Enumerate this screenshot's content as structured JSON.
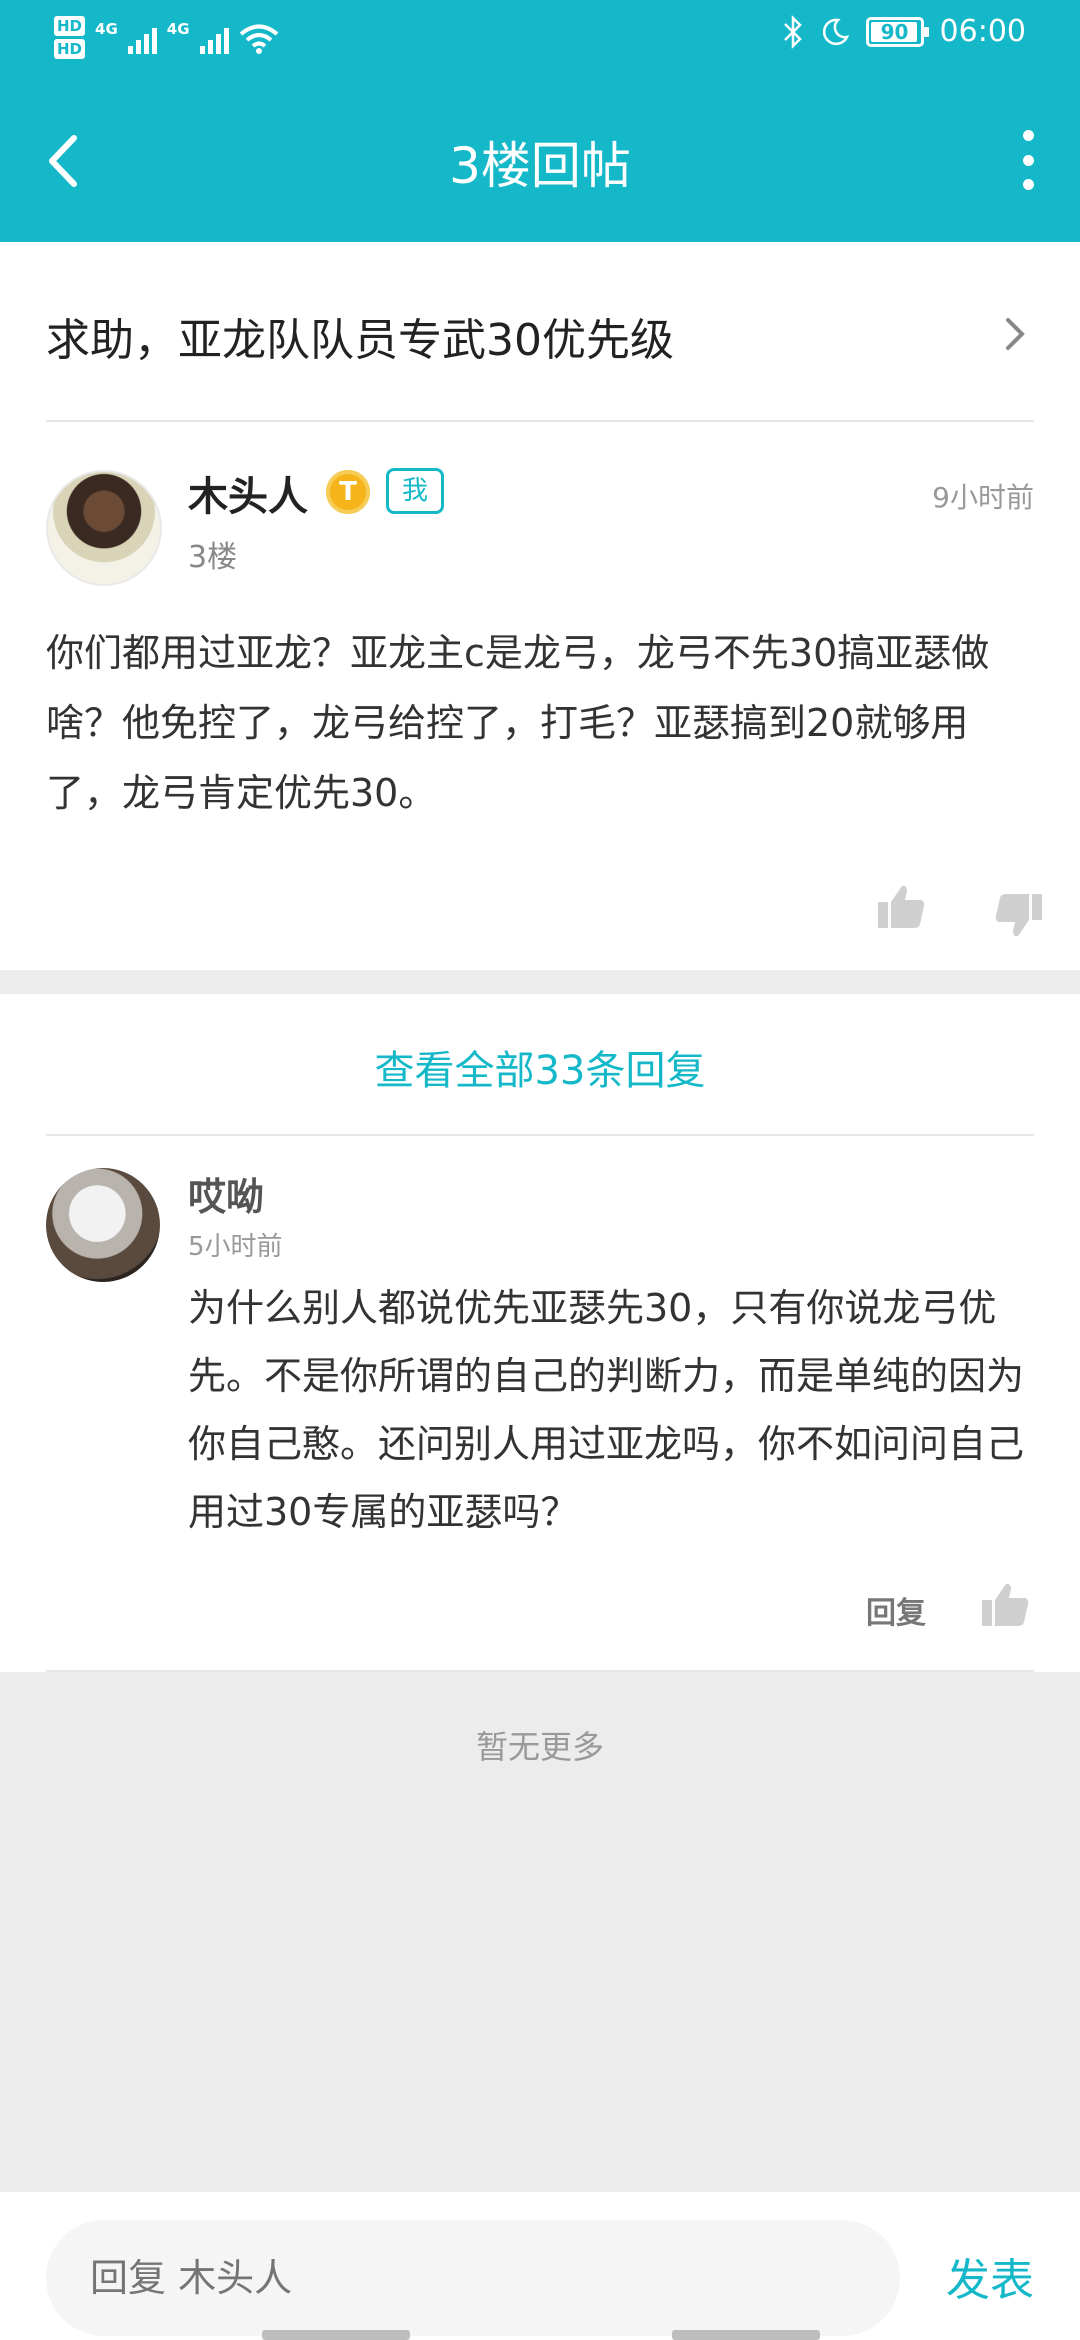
{
  "status_bar": {
    "network_left_1": "HD",
    "network_left_2": "HD",
    "network_type_1": "4G",
    "network_type_2": "4G",
    "battery_level": "90",
    "time": "06:00",
    "icons": [
      "bluetooth-icon",
      "moon-icon",
      "wifi-icon",
      "signal-icon",
      "battery-icon"
    ]
  },
  "app_bar": {
    "title": "3楼回帖"
  },
  "thread": {
    "title": "求助，亚龙队队员专武30优先级"
  },
  "original_post": {
    "author": "木头人",
    "level_badge": "T",
    "me_badge": "我",
    "floor": "3楼",
    "time": "9小时前",
    "body": "你们都用过亚龙？亚龙主c是龙弓，龙弓不先30搞亚瑟做啥？他免控了，龙弓给控了，打毛？亚瑟搞到20就够用了，龙弓肯定优先30。"
  },
  "replies": {
    "view_all": "查看全部33条回复",
    "items": [
      {
        "author": "哎呦",
        "time": "5小时前",
        "body": "为什么别人都说优先亚瑟先30，只有你说龙弓优先。不是你所谓的自己的判断力，而是单纯的因为你自己憨。还问别人用过亚龙吗，你不如问问自己用过30专属的亚瑟吗？",
        "reply_label": "回复"
      }
    ],
    "no_more": "暂无更多"
  },
  "composer": {
    "placeholder": "回复 木头人",
    "send_label": "发表"
  },
  "colors": {
    "accent": "#14b8c8",
    "background": "#ececec",
    "gold_badge": "#f4b41a"
  }
}
